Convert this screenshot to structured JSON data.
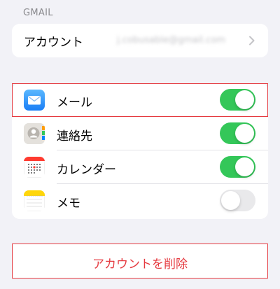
{
  "section": {
    "header": "GMAIL"
  },
  "account": {
    "label": "アカウント",
    "value": "j.cobusable@gmail.com"
  },
  "apps": [
    {
      "label": "メール",
      "icon": "mail-icon",
      "enabled": true
    },
    {
      "label": "連絡先",
      "icon": "contacts-icon",
      "enabled": true
    },
    {
      "label": "カレンダー",
      "icon": "calendar-icon",
      "enabled": true
    },
    {
      "label": "メモ",
      "icon": "notes-icon",
      "enabled": false
    }
  ],
  "delete": {
    "label": "アカウントを削除"
  },
  "colors": {
    "accent_green": "#34c759",
    "destructive": "#e53a40",
    "mail_blue": "#1a8cff"
  }
}
